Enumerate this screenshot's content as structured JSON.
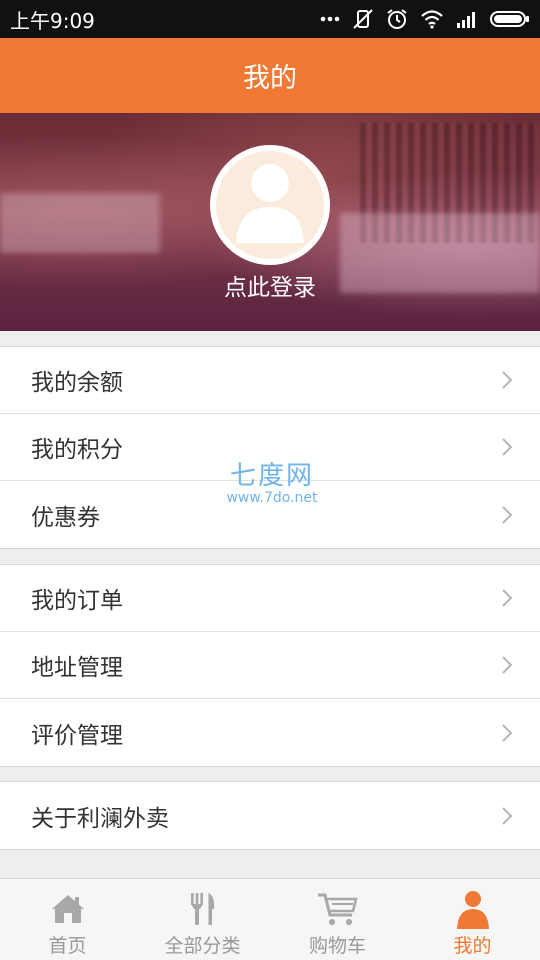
{
  "status_bar": {
    "time": "上午9:09",
    "icons": [
      "more-dots-icon",
      "mute-icon",
      "alarm-icon",
      "wifi-icon",
      "signal-icon",
      "battery-icon"
    ]
  },
  "header": {
    "title": "我的"
  },
  "profile": {
    "login_text": "点此登录",
    "avatar_icon": "user-avatar-icon"
  },
  "menu": {
    "group1": [
      {
        "label": "我的余额"
      },
      {
        "label": "我的积分"
      },
      {
        "label": "优惠券"
      }
    ],
    "group2": [
      {
        "label": "我的订单"
      },
      {
        "label": "地址管理"
      },
      {
        "label": "评价管理"
      }
    ],
    "group3": [
      {
        "label": "关于利澜外卖"
      }
    ]
  },
  "watermark": {
    "main": "七度网",
    "url": "www.7do.net"
  },
  "bottom_nav": {
    "items": [
      {
        "label": "首页",
        "icon": "home-icon"
      },
      {
        "label": "全部分类",
        "icon": "utensils-icon"
      },
      {
        "label": "购物车",
        "icon": "cart-icon"
      },
      {
        "label": "我的",
        "icon": "person-icon"
      }
    ],
    "active_index": 3
  },
  "colors": {
    "accent": "#f07a35",
    "status_bar": "#111111",
    "inactive_nav": "#999999"
  }
}
